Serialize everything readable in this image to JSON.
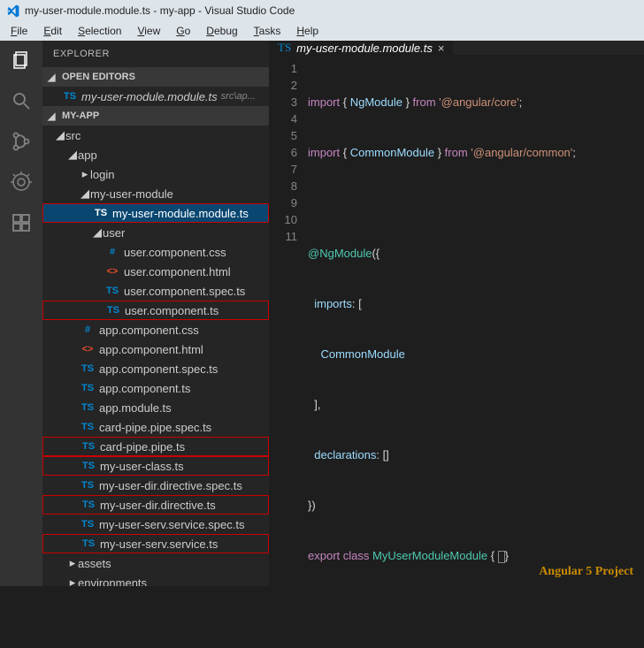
{
  "titlebar": {
    "text": "my-user-module.module.ts - my-app - Visual Studio Code"
  },
  "menubar": [
    "File",
    "Edit",
    "Selection",
    "View",
    "Go",
    "Debug",
    "Tasks",
    "Help"
  ],
  "explorer": {
    "title": "EXPLORER"
  },
  "sections": {
    "openEditors": "OPEN EDITORS",
    "project": "MY-APP"
  },
  "openEditorItem": {
    "name": "my-user-module.module.ts",
    "path": "src\\ap..."
  },
  "tree": {
    "src": "src",
    "app": "app",
    "login": "login",
    "myUserModule": "my-user-module",
    "myUserModuleTs": "my-user-module.module.ts",
    "user": "user",
    "userCss": "user.component.css",
    "userHtml": "user.component.html",
    "userSpec": "user.component.spec.ts",
    "userTs": "user.component.ts",
    "appCss": "app.component.css",
    "appHtml": "app.component.html",
    "appSpec": "app.component.spec.ts",
    "appTs": "app.component.ts",
    "appModule": "app.module.ts",
    "cardPipeSpec": "card-pipe.pipe.spec.ts",
    "cardPipe": "card-pipe.pipe.ts",
    "myUserClass": "my-user-class.ts",
    "myUserDirSpec": "my-user-dir.directive.spec.ts",
    "myUserDir": "my-user-dir.directive.ts",
    "myUserServSpec": "my-user-serv.service.spec.ts",
    "myUserServ": "my-user-serv.service.ts",
    "assets": "assets",
    "environments": "environments"
  },
  "icons": {
    "ts": "TS",
    "css": "#",
    "html": "<>"
  },
  "tab": {
    "name": "my-user-module.module.ts",
    "close": "×"
  },
  "code": {
    "lines": [
      "1",
      "2",
      "3",
      "4",
      "5",
      "6",
      "7",
      "8",
      "9",
      "10",
      "11"
    ],
    "l1_import": "import",
    "l1_ng": "NgModule",
    "l1_from": "from",
    "l1_str": "'@angular/core'",
    "l2_cm": "CommonModule",
    "l2_str": "'@angular/common'",
    "l4_dec": "@NgModule",
    "l5_imports": "imports",
    "l6_cm": "CommonModule",
    "l8_decl": "declarations",
    "l10_export": "export",
    "l10_class": "class",
    "l10_name": "MyUserModuleModule"
  },
  "footer": "Angular 5 Project"
}
